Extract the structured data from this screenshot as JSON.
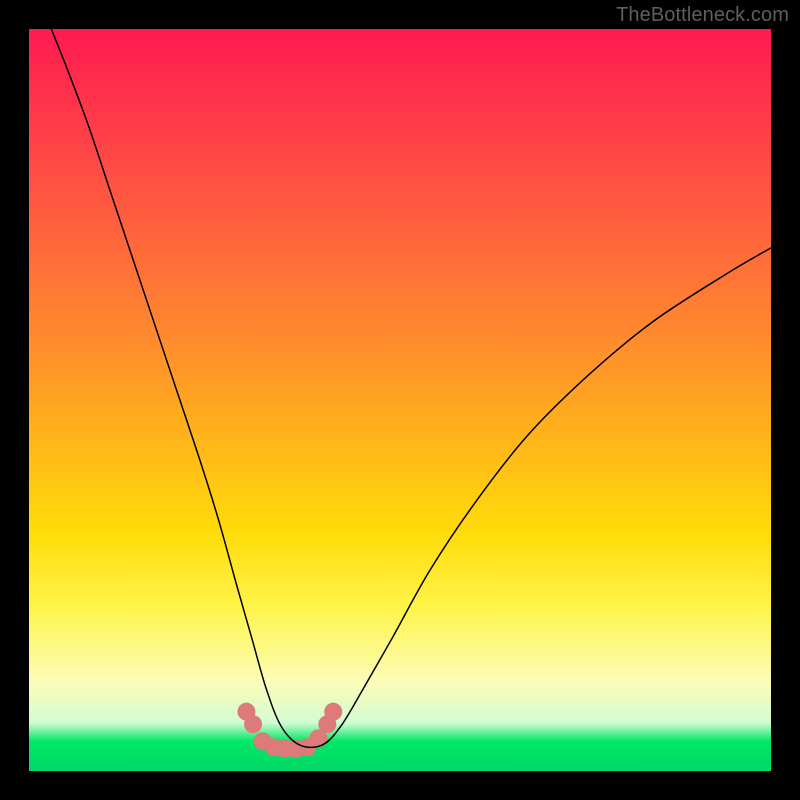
{
  "watermark": "TheBottleneck.com",
  "chart_data": {
    "type": "line",
    "title": "",
    "xlabel": "",
    "ylabel": "",
    "xlim": [
      0,
      100
    ],
    "ylim": [
      0,
      100
    ],
    "series": [
      {
        "name": "bottleneck-curve",
        "color": "#000000",
        "stroke_width": 1.5,
        "x": [
          3.0,
          5.0,
          8.0,
          11.0,
          14.0,
          17.0,
          20.0,
          23.0,
          25.5,
          28.0,
          30.0,
          32.0,
          34.0,
          36.5,
          39.5,
          42.0,
          45.0,
          49.0,
          54.0,
          60.0,
          67.0,
          75.0,
          84.0,
          94.0,
          100.0
        ],
        "y": [
          100.0,
          95.0,
          87.0,
          78.0,
          69.0,
          60.0,
          51.0,
          42.0,
          34.0,
          25.0,
          18.0,
          11.0,
          6.0,
          3.5,
          3.5,
          6.0,
          11.0,
          18.0,
          27.0,
          36.0,
          45.0,
          53.0,
          60.5,
          67.0,
          70.5
        ]
      },
      {
        "name": "markers",
        "type": "scatter",
        "color": "#dd7a7a",
        "marker_radius_px": 9,
        "x": [
          29.3,
          30.2,
          31.5,
          33.0,
          34.5,
          36.0,
          37.5,
          39.0,
          40.2,
          41.0
        ],
        "y": [
          8.0,
          6.3,
          4.0,
          3.2,
          3.0,
          3.0,
          3.2,
          4.4,
          6.3,
          8.0
        ]
      }
    ],
    "background_gradient": {
      "stops": [
        {
          "pos": 0.0,
          "color": "#ff1a50"
        },
        {
          "pos": 0.3,
          "color": "#ff6a3a"
        },
        {
          "pos": 0.68,
          "color": "#ffdc0a"
        },
        {
          "pos": 0.88,
          "color": "#fcfcb8"
        },
        {
          "pos": 0.96,
          "color": "#00e865"
        },
        {
          "pos": 1.0,
          "color": "#00d868"
        }
      ]
    }
  }
}
